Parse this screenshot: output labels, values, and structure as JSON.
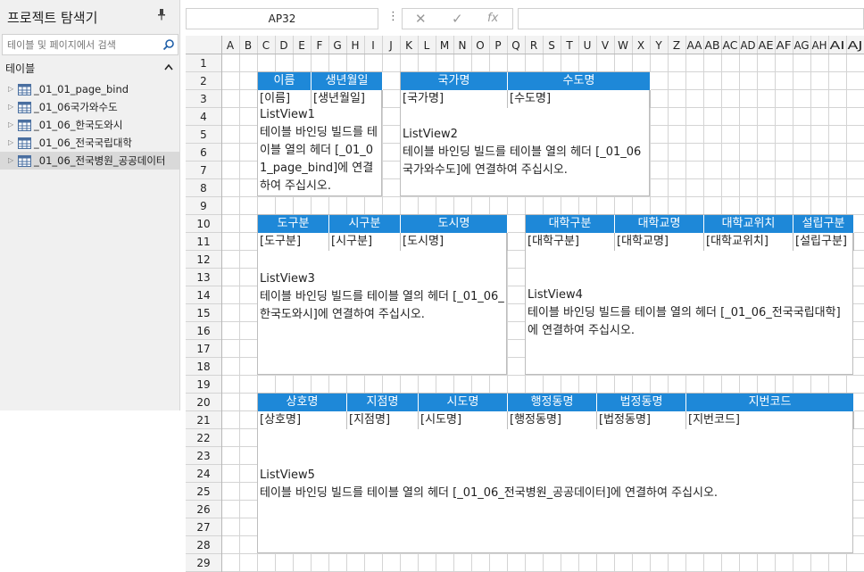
{
  "explorer": {
    "title": "프로젝트 탐색기",
    "pin_icon": "pin-icon",
    "search_placeholder": "테이블 및 페이지에서 검색",
    "section_label": "테이블",
    "items": [
      {
        "label": "_01_01_page_bind"
      },
      {
        "label": "_01_06국가와수도"
      },
      {
        "label": "_01_06_한국도와시"
      },
      {
        "label": "_01_06_전국국립대학"
      },
      {
        "label": "_01_06_전국병원_공공데이터"
      }
    ]
  },
  "formula_bar": {
    "cell_ref": "AP32",
    "cancel_icon": "✕",
    "confirm_icon": "✓",
    "fx_icon": "fx",
    "formula": ""
  },
  "sheet": {
    "columns": [
      "A",
      "B",
      "C",
      "D",
      "E",
      "F",
      "G",
      "H",
      "I",
      "J",
      "K",
      "L",
      "M",
      "N",
      "O",
      "P",
      "Q",
      "R",
      "S",
      "T",
      "U",
      "V",
      "W",
      "X",
      "Y",
      "Z",
      "AA",
      "AB",
      "AC",
      "AD",
      "AE",
      "AF",
      "AG",
      "AH",
      "AI",
      "AJ"
    ],
    "rows": [
      "1",
      "2",
      "3",
      "4",
      "5",
      "6",
      "7",
      "8",
      "9",
      "10",
      "11",
      "12",
      "13",
      "14",
      "15",
      "16",
      "17",
      "18",
      "19",
      "20",
      "21",
      "22",
      "23",
      "24",
      "25",
      "26",
      "27",
      "28",
      "29"
    ]
  },
  "listviews": [
    {
      "headers": [
        "이름",
        "생년월일"
      ],
      "binds": [
        "[이름]",
        "[생년월일]"
      ],
      "name": "ListView1",
      "message": "테이블 바인딩 빌드를 테이블 열의 헤더 [_01_01_page_bind]에 연결하여 주십시오."
    },
    {
      "headers": [
        "국가명",
        "수도명"
      ],
      "binds": [
        "[국가명]",
        "[수도명]"
      ],
      "name": "ListView2",
      "message": "테이블 바인딩 빌드를 테이블 열의 헤더 [_01_06국가와수도]에 연결하여 주십시오."
    },
    {
      "headers": [
        "도구분",
        "시구분",
        "도시명"
      ],
      "binds": [
        "[도구분]",
        "[시구분]",
        "[도시명]"
      ],
      "name": "ListView3",
      "message": "테이블 바인딩 빌드를 테이블 열의 헤더 [_01_06_한국도와시]에 연결하여 주십시오."
    },
    {
      "headers": [
        "대학구분",
        "대학교명",
        "대학교위치",
        "설립구분"
      ],
      "binds": [
        "[대학구분]",
        "[대학교명]",
        "[대학교위치]",
        "[설립구분]"
      ],
      "name": "ListView4",
      "message": "테이블 바인딩 빌드를 테이블 열의 헤더 [_01_06_전국국립대학]에 연결하여 주십시오."
    },
    {
      "headers": [
        "상호명",
        "지점명",
        "시도명",
        "행정동명",
        "법정동명",
        "지번코드"
      ],
      "binds": [
        "[상호명]",
        "[지점명]",
        "[시도명]",
        "[행정동명]",
        "[법정동명]",
        "[지번코드]"
      ],
      "name": "ListView5",
      "message": "테이블 바인딩 빌드를 테이블 열의 헤더 [_01_06_전국병원_공공데이터]에 연결하여 주십시오."
    }
  ],
  "colors": {
    "header_blue": "#1e88d8",
    "grid_line": "#d4d4d4"
  }
}
